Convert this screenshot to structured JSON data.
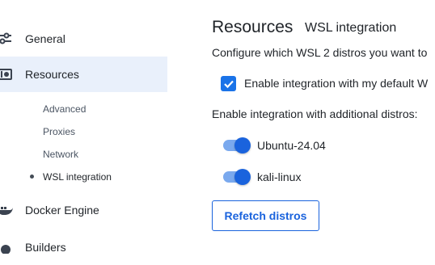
{
  "sidebar": {
    "general": "General",
    "resources": "Resources",
    "sub_items": [
      "Advanced",
      "Proxies",
      "Network",
      "WSL integration"
    ],
    "docker_engine": "Docker Engine",
    "builders": "Builders"
  },
  "main": {
    "title": "Resources",
    "subtitle": "WSL integration",
    "description": "Configure which WSL 2 distros you want to",
    "default_checkbox_label": "Enable integration with my default W",
    "additional_label": "Enable integration with additional distros:",
    "distros": [
      "Ubuntu-24.04",
      "kali-linux"
    ],
    "refetch_button": "Refetch distros"
  },
  "colors": {
    "accent": "#1a63dd",
    "active_bg": "#e9f0fb"
  }
}
